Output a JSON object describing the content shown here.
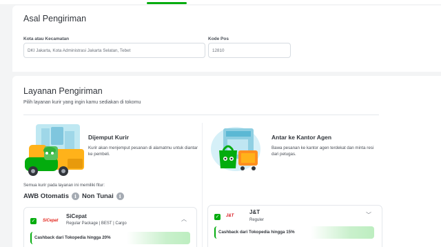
{
  "origin": {
    "title": "Asal Pengiriman",
    "city_label": "Kota atau Kecamatan",
    "city_value": "DKI Jakarta, Kota Administrasi Jakarta Selatan, Tebet",
    "postal_label": "Kode Pos",
    "postal_value": "12810"
  },
  "service": {
    "title": "Layanan Pengiriman",
    "subtitle": "Pilih layanan kurir yang ingin kamu sediakan di tokomu",
    "options": [
      {
        "title": "Dijemput Kurir",
        "desc": "Kurir akan menjemput pesanan di alamatmu untuk diantar ke pembeli."
      },
      {
        "title": "Antar ke Kantor Agen",
        "desc": "Bawa pesanan ke kantor agen terdekat dan minta resi dari petugas."
      }
    ],
    "features_note": "Semua kurir pada layanan ini memiliki fitur:",
    "features": [
      "AWB Otomatis",
      "Non Tunai"
    ]
  },
  "couriers": [
    {
      "logo": "SiCepat",
      "name": "SiCepat",
      "services": "Regular Package | BEST | Cargo",
      "cashback": "Cashback dari Tokopedia hingga 20%",
      "expanded": true
    },
    {
      "logo": "J&T",
      "name": "J&T",
      "services": "Reguler",
      "cashback": "Cashback dari Tokopedia hingga 15%",
      "expanded": false
    }
  ],
  "icons": {
    "check": "✓",
    "info": "i",
    "chevron_up": "︿",
    "chevron_down": "﹀"
  },
  "colors": {
    "accent": "#03ac0e",
    "page_bg": "#f3f4f5"
  }
}
